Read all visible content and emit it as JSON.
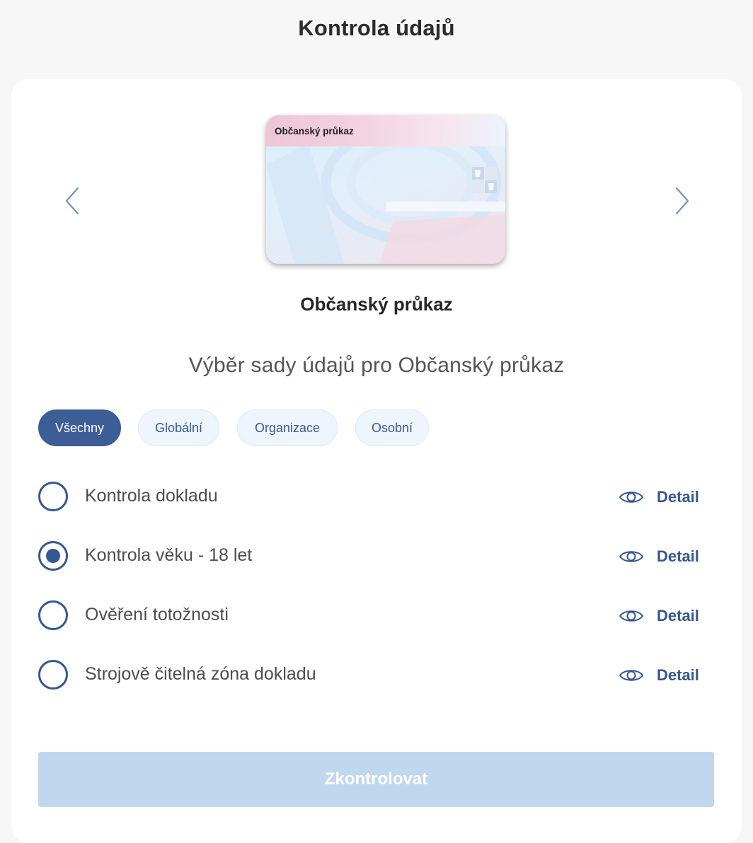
{
  "page": {
    "title": "Kontrola údajů"
  },
  "carousel": {
    "card_label": "Občanský průkaz",
    "document_name": "Občanský průkaz",
    "prev_icon": "chevron-left-icon",
    "next_icon": "chevron-right-icon"
  },
  "section": {
    "title": "Výběr sady údajů pro Občanský průkaz"
  },
  "filters": [
    {
      "label": "Všechny",
      "active": true
    },
    {
      "label": "Globální",
      "active": false
    },
    {
      "label": "Organizace",
      "active": false
    },
    {
      "label": "Osobní",
      "active": false
    }
  ],
  "options": [
    {
      "label": "Kontrola dokladu",
      "selected": false,
      "detail_label": "Detail"
    },
    {
      "label": "Kontrola věku - 18 let",
      "selected": true,
      "detail_label": "Detail"
    },
    {
      "label": "Ověření totožnosti",
      "selected": false,
      "detail_label": "Detail"
    },
    {
      "label": "Strojově čitelná zóna dokladu",
      "selected": false,
      "detail_label": "Detail"
    }
  ],
  "submit": {
    "label": "Zkontrolovat",
    "disabled": true
  },
  "colors": {
    "accent": "#3c5d96",
    "chip_inactive_bg": "#eef5fd",
    "button_disabled_bg": "#c1d7ee",
    "page_bg": "#f6f6f6"
  }
}
